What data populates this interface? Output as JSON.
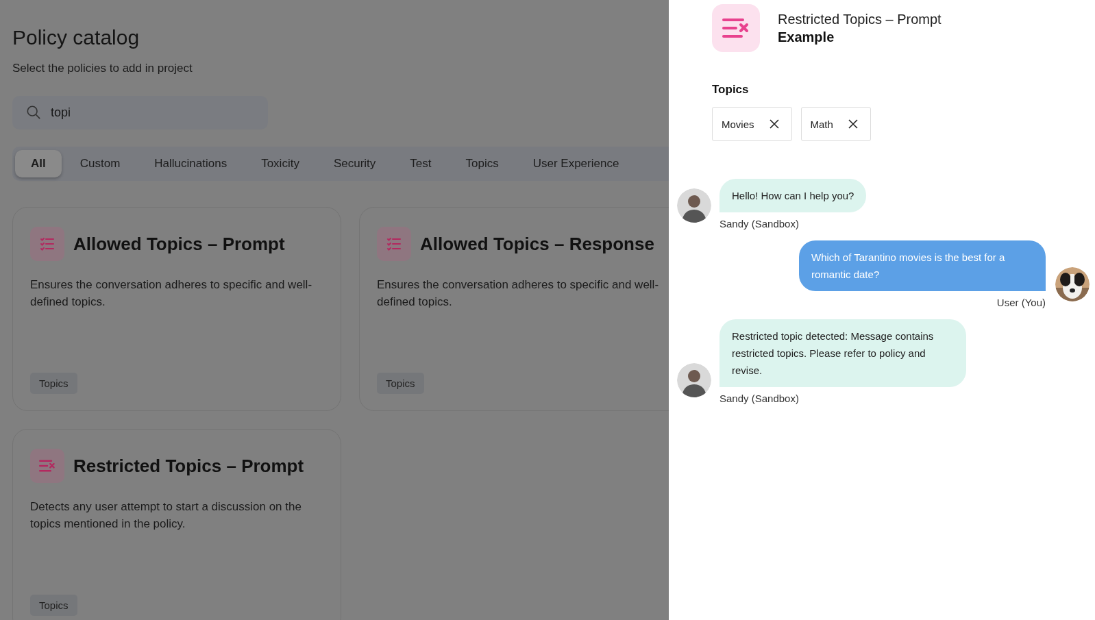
{
  "catalog": {
    "title": "Policy catalog",
    "subtitle": "Select the policies to add in project"
  },
  "search": {
    "value": "topi"
  },
  "tabs": [
    {
      "label": "All",
      "selected": true
    },
    {
      "label": "Custom",
      "selected": false
    },
    {
      "label": "Hallucinations",
      "selected": false
    },
    {
      "label": "Toxicity",
      "selected": false
    },
    {
      "label": "Security",
      "selected": false
    },
    {
      "label": "Test",
      "selected": false
    },
    {
      "label": "Topics",
      "selected": false
    },
    {
      "label": "User Experience",
      "selected": false
    }
  ],
  "cards": [
    {
      "kind": "allowed",
      "title": "Allowed Topics – Prompt",
      "description": "Ensures the conversation adheres to specific and well-defined topics.",
      "tag": "Topics"
    },
    {
      "kind": "allowed",
      "title": "Allowed Topics – Response",
      "description": "Ensures the conversation adheres to specific and well-defined topics.",
      "tag": "Topics"
    },
    {
      "kind": "restricted",
      "title": "Restricted Topics – Prompt",
      "description": "Detects any user attempt to start a discussion on the topics mentioned in the policy.",
      "tag": "Topics"
    }
  ],
  "drawer": {
    "kind": "restricted",
    "title": "Restricted Topics – Prompt",
    "subtitle": "Example",
    "topics_label": "Topics",
    "topics": [
      "Movies",
      "Math"
    ],
    "messages": [
      {
        "kind": "bot",
        "text": "Hello! How can I help you?",
        "author": "Sandy (Sandbox)"
      },
      {
        "kind": "user",
        "text": "Which of Tarantino movies is the best for a romantic date?",
        "author": "User (You)"
      },
      {
        "kind": "bot",
        "text": "Restricted topic detected: Message contains restricted topics. Please refer to policy and revise.",
        "author": "Sandy (Sandbox)"
      }
    ]
  }
}
